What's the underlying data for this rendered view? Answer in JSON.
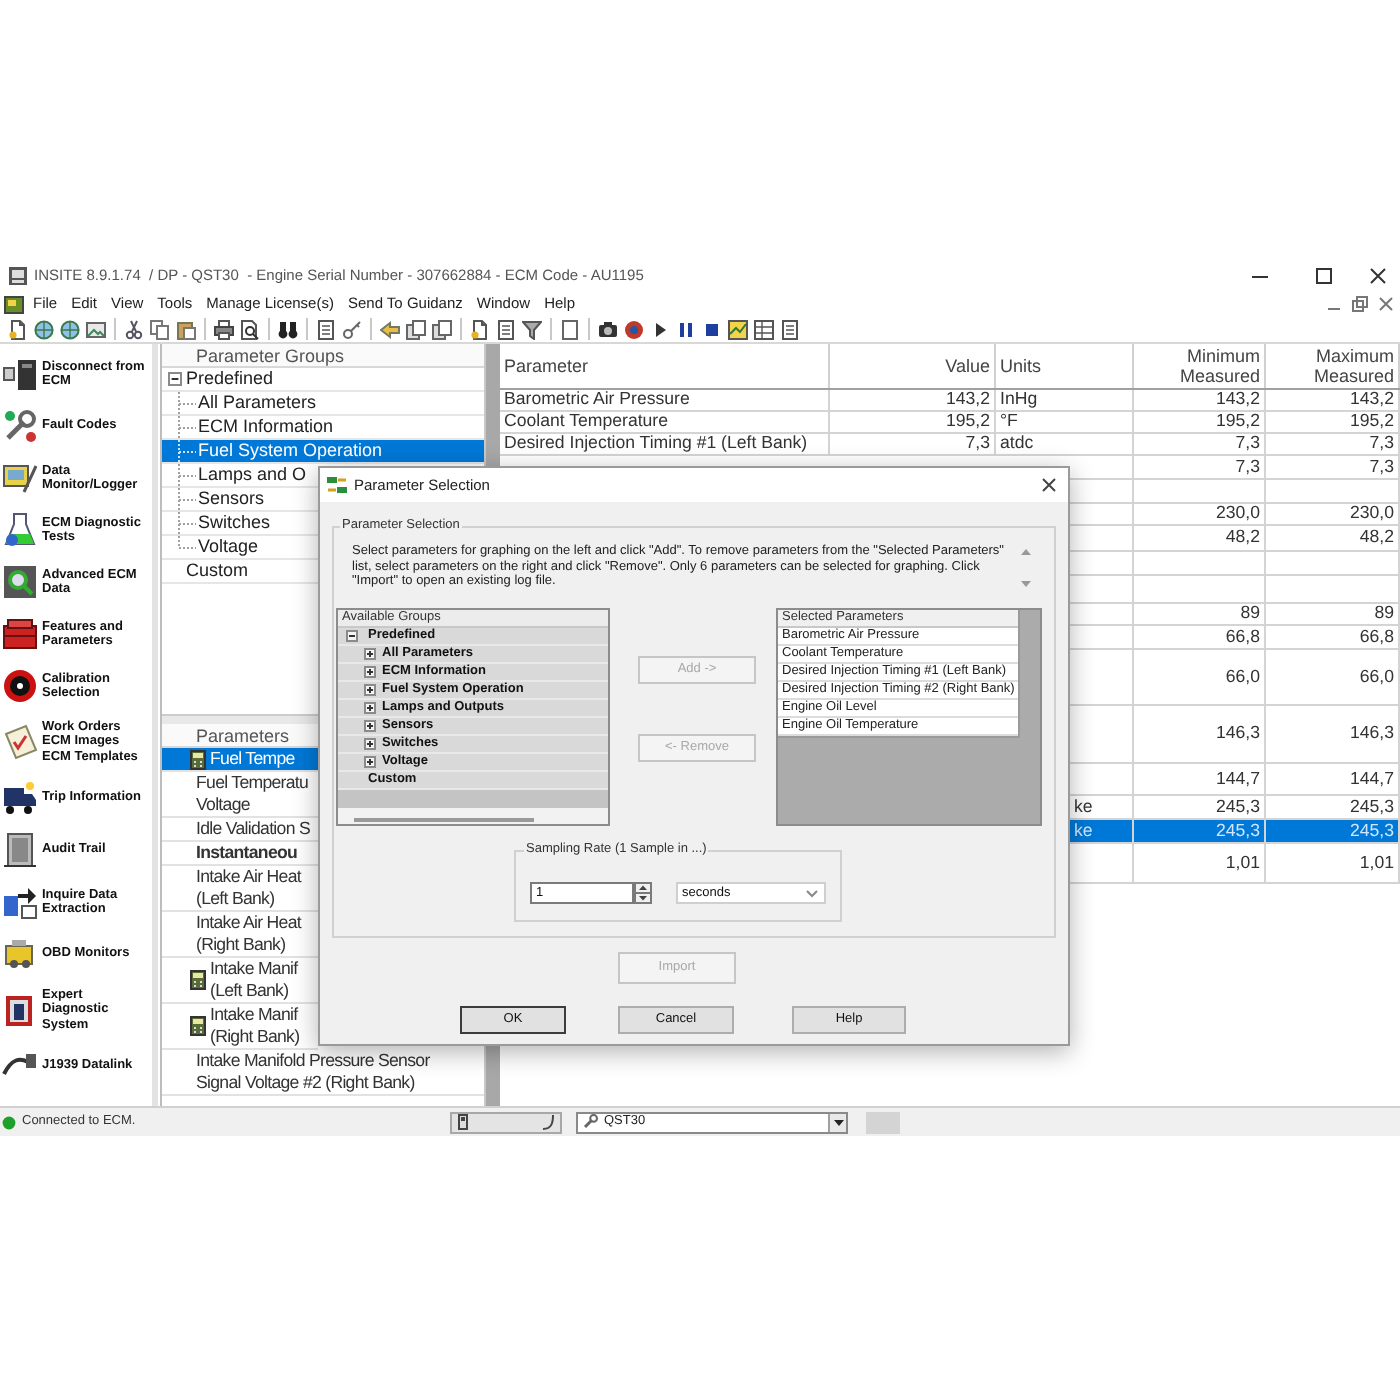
{
  "window": {
    "title": "INSITE 8.9.1.74  / DP - QST30  - Engine Serial Number - 307662884 - ECM Code - AU1195"
  },
  "menu": [
    "File",
    "Edit",
    "View",
    "Tools",
    "Manage License(s)",
    "Send To Guidanz",
    "Window",
    "Help"
  ],
  "sidebar": {
    "items": [
      {
        "lines": [
          "Disconnect from",
          "ECM"
        ]
      },
      {
        "lines": [
          "Fault Codes"
        ]
      },
      {
        "lines": [
          "Data",
          "Monitor/Logger"
        ]
      },
      {
        "lines": [
          "ECM Diagnostic",
          "Tests"
        ]
      },
      {
        "lines": [
          "Advanced ECM",
          "Data"
        ]
      },
      {
        "lines": [
          "Features and",
          "Parameters"
        ]
      },
      {
        "lines": [
          "Calibration",
          "Selection"
        ]
      },
      {
        "lines": [
          "Work Orders",
          "ECM Images",
          "ECM Templates"
        ]
      },
      {
        "lines": [
          "Trip Information"
        ]
      },
      {
        "lines": [
          "Audit Trail"
        ]
      },
      {
        "lines": [
          "Inquire Data",
          "Extraction"
        ]
      },
      {
        "lines": [
          "OBD Monitors"
        ]
      },
      {
        "lines": [
          "Expert",
          "Diagnostic",
          "System"
        ]
      },
      {
        "lines": [
          "J1939 Datalink"
        ]
      }
    ]
  },
  "parameter_groups": {
    "header": "Parameter Groups",
    "tree": [
      {
        "label": "Predefined",
        "selected": false,
        "expanded": true,
        "children": [
          {
            "label": "All Parameters",
            "selected": false
          },
          {
            "label": "ECM Information",
            "selected": false
          },
          {
            "label": "Fuel System Operation",
            "selected": true
          },
          {
            "label": "Lamps and O",
            "selected": false
          },
          {
            "label": "Sensors",
            "selected": false
          },
          {
            "label": "Switches",
            "selected": false
          },
          {
            "label": "Voltage",
            "selected": false
          }
        ]
      },
      {
        "label": "Custom",
        "selected": false
      }
    ]
  },
  "parameters": {
    "header": "Parameters",
    "items": [
      {
        "lines": [
          "Fuel Tempe"
        ],
        "selected": true,
        "has_icon": true,
        "bold": false
      },
      {
        "lines": [
          "Fuel Temperatu",
          "Voltage"
        ],
        "selected": false,
        "has_icon": false,
        "bold": false
      },
      {
        "lines": [
          "Idle Validation S"
        ],
        "selected": false,
        "has_icon": false,
        "bold": false
      },
      {
        "lines": [
          "Instantaneou"
        ],
        "selected": false,
        "has_icon": false,
        "bold": true
      },
      {
        "lines": [
          "Intake Air Heat",
          "(Left Bank)"
        ],
        "selected": false,
        "has_icon": false,
        "bold": false
      },
      {
        "lines": [
          "Intake Air Heat",
          "(Right Bank)"
        ],
        "selected": false,
        "has_icon": false,
        "bold": false
      },
      {
        "lines": [
          "Intake Manif",
          "(Left Bank)"
        ],
        "selected": false,
        "has_icon": true,
        "bold": false
      },
      {
        "lines": [
          "Intake Manif",
          "(Right Bank)"
        ],
        "selected": false,
        "has_icon": true,
        "bold": false
      },
      {
        "lines": [
          "Intake Manifold Pressure Sensor",
          "Signal Voltage #2 (Right Bank)"
        ],
        "selected": false,
        "has_icon": false,
        "bold": false
      }
    ]
  },
  "table": {
    "columns": [
      "Parameter",
      "Value",
      "Units",
      "Minimum Measured",
      "Maximum Measured"
    ],
    "rows": [
      {
        "parameter": "Barometric Air Pressure",
        "value": "143,2",
        "units": "InHg",
        "minimum": "143,2",
        "maximum": "143,2",
        "selected": false
      },
      {
        "parameter": "Coolant Temperature",
        "value": "195,2",
        "units": "°F",
        "minimum": "195,2",
        "maximum": "195,2",
        "selected": false
      },
      {
        "parameter": "Desired Injection Timing #1 (Left Bank)",
        "value": "7,3",
        "units": "atdc",
        "minimum": "7,3",
        "maximum": "7,3",
        "selected": false
      },
      {
        "minimum": "7,3",
        "maximum": "7,3",
        "selected": false
      },
      {
        "selected": false
      },
      {
        "minimum": "230,0",
        "maximum": "230,0",
        "selected": false
      },
      {
        "minimum": "48,2",
        "maximum": "48,2",
        "selected": false
      },
      {
        "selected": false
      },
      {
        "selected": false
      },
      {
        "minimum": "89",
        "maximum": "89",
        "selected": false
      },
      {
        "minimum": "66,8",
        "maximum": "66,8",
        "selected": false
      },
      {
        "minimum": "66,0",
        "maximum": "66,0",
        "selected": false
      },
      {
        "minimum": "146,3",
        "maximum": "146,3",
        "selected": false
      },
      {
        "minimum": "144,7",
        "maximum": "144,7",
        "selected": false
      },
      {
        "units": "ke",
        "minimum": "245,3",
        "maximum": "245,3",
        "selected": false
      },
      {
        "units": "ke",
        "minimum": "245,3",
        "maximum": "245,3",
        "selected": true
      },
      {
        "minimum": "1,01",
        "maximum": "1,01",
        "selected": false
      }
    ]
  },
  "dialog": {
    "title": "Parameter Selection",
    "group_label": "Parameter Selection",
    "instructions": "Select parameters for graphing on the left and click \"Add\". To remove parameters from the \"Selected Parameters\" list, select parameters on the right and click \"Remove\". Only 6 parameters can be selected for graphing. Click \"Import\" to open an existing log file.",
    "available_groups": {
      "header": "Available Groups",
      "tree": [
        {
          "label": "Predefined",
          "expanded": true,
          "children": [
            {
              "label": "All Parameters",
              "expanded": false
            },
            {
              "label": "ECM Information",
              "expanded": false
            },
            {
              "label": "Fuel System Operation",
              "expanded": false
            },
            {
              "label": "Lamps and Outputs",
              "expanded": false
            },
            {
              "label": "Sensors",
              "expanded": false
            },
            {
              "label": "Switches",
              "expanded": false
            },
            {
              "label": "Voltage",
              "expanded": false
            }
          ]
        },
        {
          "label": "Custom"
        }
      ]
    },
    "add_button": {
      "label": "Add ->",
      "disabled": true
    },
    "remove_button": {
      "label": "<- Remove",
      "disabled": true
    },
    "selected_parameters": {
      "header": "Selected Parameters",
      "items": [
        "Barometric Air Pressure",
        "Coolant Temperature",
        "Desired Injection Timing #1 (Left Bank)",
        "Desired Injection Timing #2 (Right Bank)",
        "Engine Oil Level",
        "Engine Oil Temperature"
      ]
    },
    "sampling_rate": {
      "label": "Sampling Rate (1 Sample in ...)",
      "value": "1",
      "unit": "seconds"
    },
    "import_button": {
      "label": "Import",
      "disabled": true
    },
    "buttons": [
      {
        "label": "OK",
        "disabled": false,
        "default": true
      },
      {
        "label": "Cancel",
        "disabled": false,
        "default": false
      },
      {
        "label": "Help",
        "disabled": false,
        "default": false
      }
    ]
  },
  "status_bar": {
    "text": "Connected to ECM.",
    "connected": true,
    "engine_selector": "QST30"
  }
}
